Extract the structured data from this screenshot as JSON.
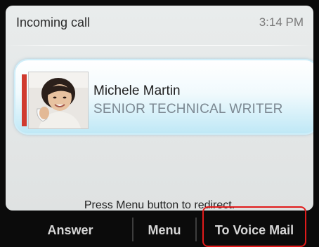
{
  "header": {
    "title": "Incoming call",
    "time": "3:14 PM"
  },
  "caller": {
    "name": "Michele Martin",
    "job_title": "SENIOR TECHNICAL WRITER"
  },
  "hint": "Press Menu button to redirect.",
  "softkeys": [
    {
      "label": "Answer"
    },
    {
      "label": "Menu"
    },
    {
      "label": "To Voice Mail"
    }
  ],
  "colors": {
    "accent": "#d03a2f",
    "highlight": "#e11b1b",
    "card_gradient_end": "#bfe8f6"
  }
}
